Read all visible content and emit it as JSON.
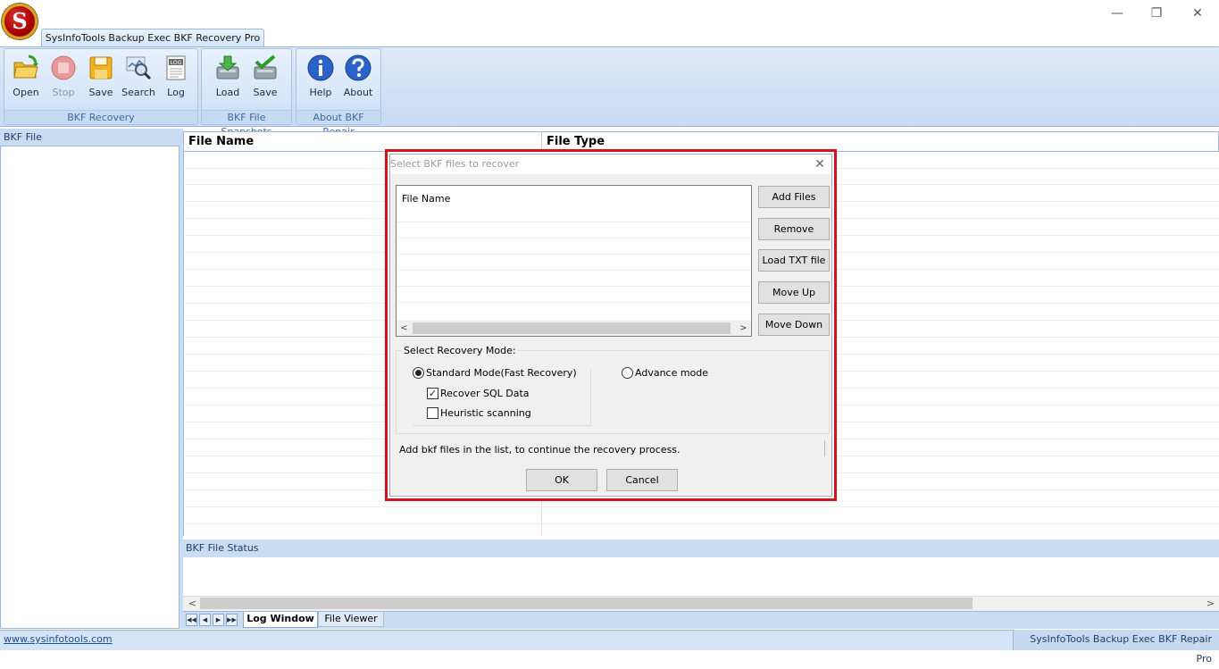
{
  "window": {
    "logo_letter": "S",
    "app_tab": "SysInfoTools Backup Exec BKF Recovery Pro",
    "controls": {
      "minimize": "—",
      "restore": "❐",
      "close": "✕"
    }
  },
  "ribbon": {
    "groups": [
      {
        "label": "BKF Recovery",
        "buttons": [
          "Open",
          "Stop",
          "Save",
          "Search",
          "Log"
        ]
      },
      {
        "label": "BKF File Snapshots",
        "buttons": [
          "Load",
          "Save"
        ]
      },
      {
        "label": "About BKF Repair",
        "buttons": [
          "Help",
          "About"
        ]
      }
    ],
    "log_icon_text": "LOG"
  },
  "left_panel": {
    "title": "BKF File"
  },
  "file_list": {
    "columns": [
      "File Name",
      "File Type"
    ]
  },
  "status_panel": {
    "title": "BKF File Status"
  },
  "bottom_tabs": {
    "log": "Log Window",
    "viewer": "File Viewer"
  },
  "statusbar": {
    "website": "www.sysinfotools.com",
    "product": "SysInfoTools Backup Exec BKF Repair Pro"
  },
  "dialog": {
    "title": "Select BKF files to recover",
    "close": "✕",
    "list_column": "File Name",
    "buttons": {
      "add": "Add Files",
      "remove": "Remove",
      "load_txt": "Load TXT file",
      "move_up": "Move Up",
      "move_down": "Move Down",
      "ok": "OK",
      "cancel": "Cancel"
    },
    "mode_legend": "Select Recovery Mode:",
    "standard_mode": "Standard Mode(Fast Recovery)",
    "standard_selected": true,
    "recover_sql": "Recover SQL Data",
    "recover_sql_checked": true,
    "heuristic": "Heuristic scanning",
    "heuristic_checked": false,
    "advance_mode": "Advance mode",
    "info": "Add bkf files in the list, to continue the recovery process."
  },
  "colors": {
    "accent": "#d6111b",
    "ribbon": "#c8dbf2",
    "panel_header": "#c9dcf2"
  }
}
